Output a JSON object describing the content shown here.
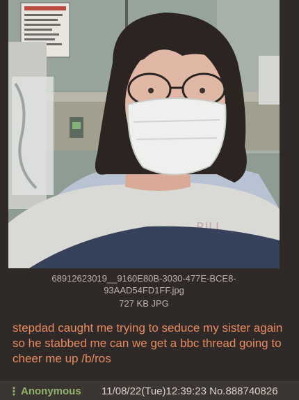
{
  "post": {
    "file": {
      "name_line1": "68912623019__9160E80B-3030-477E-BCE8-",
      "name_line2": "93AAD54FD1FF.jpg",
      "size": "727 KB JPG"
    },
    "text": "stepdad caught me trying to seduce my sister again so he stabbed me can we get a bbc thread going to cheer me up /b/ros",
    "colors": {
      "background": "#2f2a27",
      "post_text": "#e98b62",
      "name": "#8fb36c"
    }
  },
  "reply": {
    "name": "Anonymous",
    "meta": "11/08/22(Tue)12:39:23 No.888740826",
    "menu_icon": "vertical-dots-icon"
  }
}
